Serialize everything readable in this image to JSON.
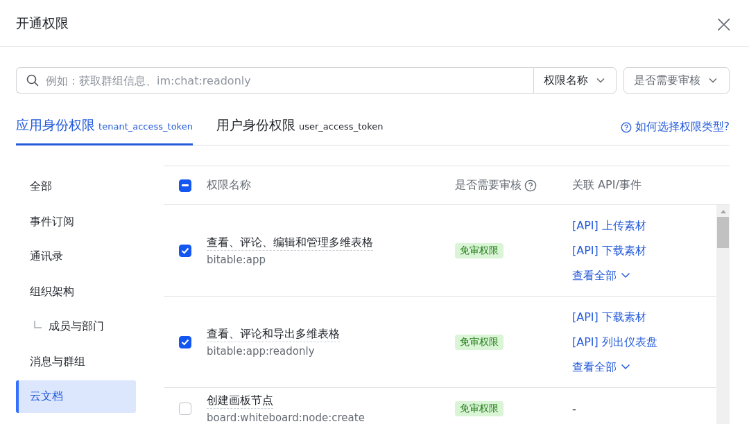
{
  "dialog": {
    "title": "开通权限",
    "close": "×"
  },
  "search": {
    "placeholder": "例如：获取群组信息、im:chat:readonly",
    "field_select": "权限名称",
    "review_select": "是否需要审核"
  },
  "tabs": [
    {
      "label": "应用身份权限",
      "token": "tenant_access_token",
      "selected": true
    },
    {
      "label": "用户身份权限",
      "token": "user_access_token",
      "selected": false
    }
  ],
  "help_link": "如何选择权限类型?",
  "sidebar": {
    "items": [
      {
        "label": "全部",
        "selected": false
      },
      {
        "label": "事件订阅",
        "selected": false
      },
      {
        "label": "通讯录",
        "selected": false
      },
      {
        "label": "组织架构",
        "selected": false,
        "children": [
          {
            "label": "成员与部门",
            "selected": false
          }
        ]
      },
      {
        "label": "消息与群组",
        "selected": false
      },
      {
        "label": "云文档",
        "selected": true
      }
    ]
  },
  "table": {
    "select_all": {
      "indeterminate": true
    },
    "columns": [
      "权限名称",
      "是否需要审核",
      "关联 API/事件"
    ],
    "rows": [
      {
        "checked": true,
        "name": "查看、评论、编辑和管理多维表格",
        "scope": "bitable:app",
        "review": "免审权限",
        "apis": [
          "[API] 上传素材",
          "[API] 下载素材"
        ],
        "more": "查看全部"
      },
      {
        "checked": true,
        "name": "查看、评论和导出多维表格",
        "scope": "bitable:app:readonly",
        "review": "免审权限",
        "apis": [
          "[API] 下载素材",
          "[API] 列出仪表盘"
        ],
        "more": "查看全部"
      },
      {
        "checked": false,
        "name": "创建画板节点",
        "scope": "board:whiteboard:node:create",
        "review": "免审权限",
        "apis": [
          "-"
        ]
      }
    ]
  }
}
